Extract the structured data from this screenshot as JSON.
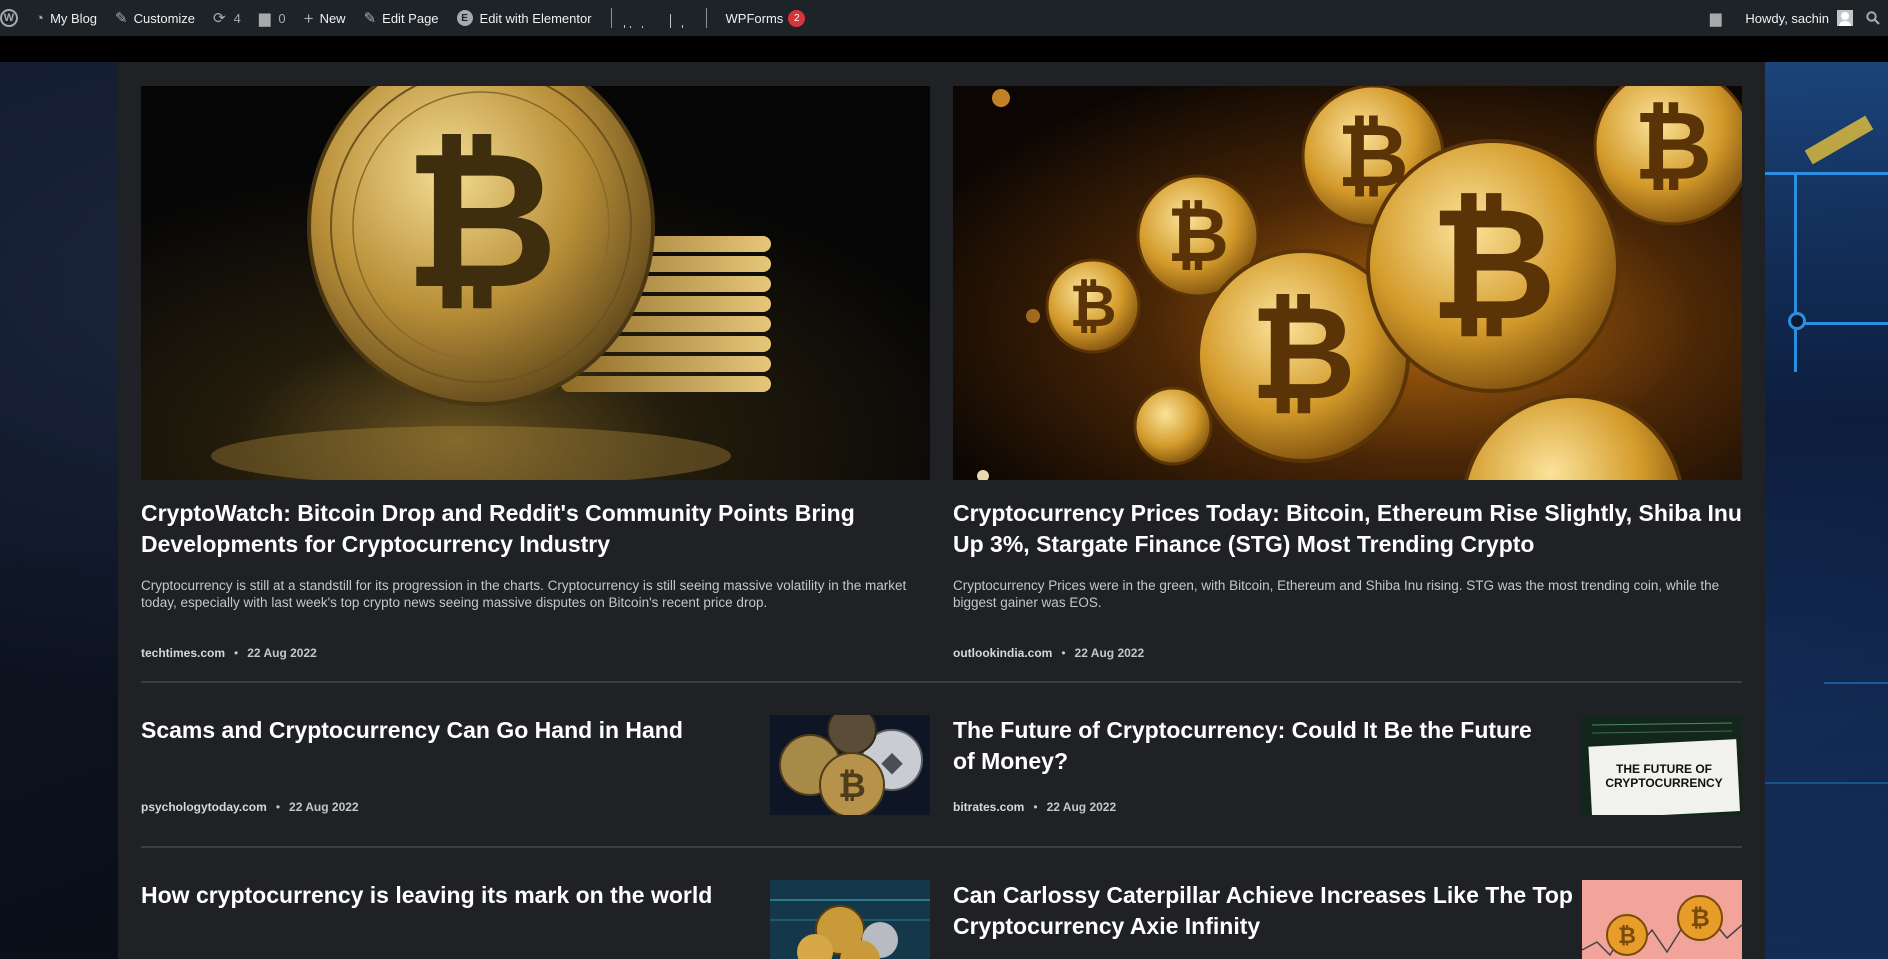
{
  "adminbar": {
    "site_name": "My Blog",
    "customize": "Customize",
    "updates_count": "4",
    "comments_count": "0",
    "new": "New",
    "edit_page": "Edit Page",
    "edit_elementor": "Edit with Elementor",
    "wpforms": "WPForms",
    "wpforms_badge": "2",
    "howdy": "Howdy, sachin"
  },
  "featured": [
    {
      "title": "CryptoWatch: Bitcoin Drop and Reddit's Community Points Bring Developments for Cryptocurrency Industry",
      "excerpt": "Cryptocurrency is still at a standstill for its progression in the charts. Cryptocurrency is still seeing massive volatility in the market today, especially with last week's top crypto news seeing massive disputes on Bitcoin's recent price drop.",
      "source": "techtimes.com",
      "date": "22 Aug 2022"
    },
    {
      "title": "Cryptocurrency Prices Today: Bitcoin, Ethereum Rise Slightly, Shiba Inu Up 3%, Stargate Finance (STG) Most Trending Crypto",
      "excerpt": "Cryptocurrency Prices were in the green, with Bitcoin, Ethereum and Shiba Inu rising. STG was the most trending coin, while the biggest gainer was EOS.",
      "source": "outlookindia.com",
      "date": "22 Aug 2022"
    }
  ],
  "list": [
    {
      "title": "Scams and Cryptocurrency Can Go Hand in Hand",
      "source": "psychologytoday.com",
      "date": "22 Aug 2022"
    },
    {
      "title": "The Future of Cryptocurrency: Could It Be the Future of Money?",
      "source": "bitrates.com",
      "date": "22 Aug 2022",
      "thumb_text": "THE FUTURE OF CRYPTOCURRENCY"
    },
    {
      "title": "How cryptocurrency is leaving its mark on the world"
    },
    {
      "title": "Can Carlossy Caterpillar Achieve Increases Like The Top Cryptocurrency Axie Infinity"
    }
  ],
  "meta_separator": "•",
  "coin_symbol": "₿",
  "colors": {
    "adminbar": "#1d2327",
    "panel": "#1f2125",
    "badge": "#d63638",
    "gold": "#d4a93a"
  }
}
